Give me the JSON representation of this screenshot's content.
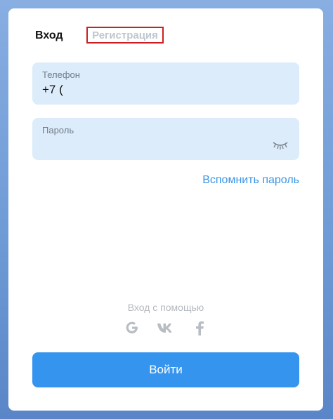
{
  "tabs": {
    "login": "Вход",
    "register": "Регистрация"
  },
  "phone": {
    "label": "Телефон",
    "value": "+7 ("
  },
  "password": {
    "label": "Пароль",
    "toggle_icon": "eye-closed-icon"
  },
  "forgot_link": "Вспомнить пароль",
  "social": {
    "caption": "Вход с помощью",
    "providers": [
      "google-icon",
      "vk-icon",
      "facebook-icon"
    ]
  },
  "submit_label": "Войти",
  "colors": {
    "accent": "#3595ee",
    "link": "#3a95e6",
    "field_bg": "#dcecfa",
    "highlight_border": "#cc1f1f"
  }
}
